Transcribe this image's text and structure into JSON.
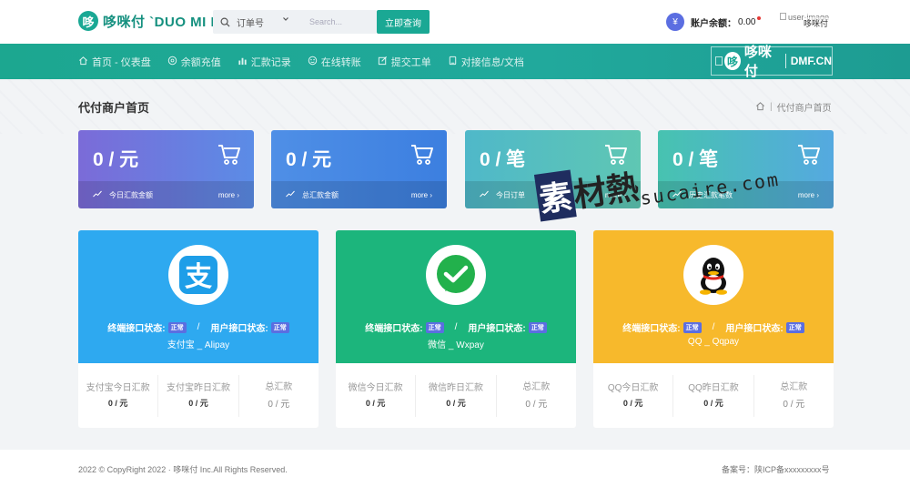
{
  "header": {
    "logo_badge": "哆",
    "logo_text": "哆咪付 `DUO MI FU",
    "order_select": "订单号",
    "search_placeholder": "Search...",
    "query_button": "立即查询",
    "yen_symbol": "¥",
    "balance_label": "账户余额：",
    "balance_value": "0.00",
    "user_image_alt": "user-image",
    "user_name": "哆咪付"
  },
  "nav": {
    "items": [
      {
        "label": "首页 - 仪表盘",
        "icon": "home-icon"
      },
      {
        "label": "余额充值",
        "icon": "coin-icon"
      },
      {
        "label": "汇款记录",
        "icon": "bar-chart-icon"
      },
      {
        "label": "在线转账",
        "icon": "transfer-icon"
      },
      {
        "label": "提交工单",
        "icon": "edit-icon"
      },
      {
        "label": "对接信息/文档",
        "icon": "doc-icon"
      }
    ],
    "brand_badge": "哆",
    "brand_name": "哆咪付",
    "brand_domain": "DMF.CN"
  },
  "page": {
    "title": "代付商户首页",
    "breadcrumb_home": "home-icon",
    "breadcrumb_current": "代付商户首页"
  },
  "stats": [
    {
      "value": "0 / 元",
      "label": "今日汇款金额",
      "more": "more",
      "color_start": "#7b6bd8",
      "color_end": "#5b8ce6"
    },
    {
      "value": "0 / 元",
      "label": "总汇款金额",
      "more": "more",
      "color_start": "#4f8fe6",
      "color_end": "#3c7fe0"
    },
    {
      "value": "0 / 笔",
      "label": "今日订单",
      "more": "more",
      "color_start": "#4fb8c9",
      "color_end": "#5fc7b3"
    },
    {
      "value": "0 / 笔",
      "label": "历史汇款笔数",
      "more": "more",
      "color_start": "#47c3b0",
      "color_end": "#55a9e0"
    }
  ],
  "payments": [
    {
      "name": "支付宝 _ Alipay",
      "terminal_label": "终端接口状态:",
      "terminal_status": "正常",
      "slash": "/",
      "user_label": "用户接口状态:",
      "user_status": "正常",
      "color": "#2ea9f0",
      "stats": [
        {
          "label": "支付宝今日汇款",
          "value": "0 / 元"
        },
        {
          "label": "支付宝昨日汇款",
          "value": "0 / 元"
        },
        {
          "label": "总汇款",
          "value": "0 / 元"
        }
      ]
    },
    {
      "name": "微信 _ Wxpay",
      "terminal_label": "终端接口状态:",
      "terminal_status": "正常",
      "slash": "/",
      "user_label": "用户接口状态:",
      "user_status": "正常",
      "color": "#1cb57c",
      "stats": [
        {
          "label": "微信今日汇款",
          "value": "0 / 元"
        },
        {
          "label": "微信昨日汇款",
          "value": "0 / 元"
        },
        {
          "label": "总汇款",
          "value": "0 / 元"
        }
      ]
    },
    {
      "name": "QQ _ Qqpay",
      "terminal_label": "终端接口状态:",
      "terminal_status": "正常",
      "slash": "/",
      "user_label": "用户接口状态:",
      "user_status": "正常",
      "color": "#f7b92c",
      "stats": [
        {
          "label": "QQ今日汇款",
          "value": "0 / 元"
        },
        {
          "label": "QQ昨日汇款",
          "value": "0 / 元"
        },
        {
          "label": "总汇款",
          "value": "0 / 元"
        }
      ]
    }
  ],
  "footer": {
    "copyright": "2022 © CopyRight 2022 · 哆咪付 Inc.All Rights Reserved.",
    "icp": "备案号：陕ICP备xxxxxxxxx号"
  },
  "watermark": {
    "chars": [
      "素",
      "材",
      "熱"
    ],
    "domain": "sucaire.com"
  }
}
